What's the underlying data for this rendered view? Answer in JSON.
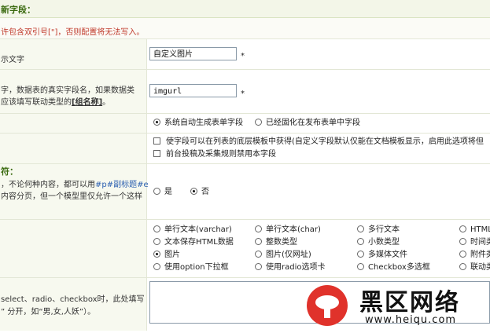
{
  "header": {
    "title": "新字段："
  },
  "warning": {
    "text": "许包含双引号[\"]，否则配置将无法写入。"
  },
  "label_row": {
    "label": "示文字",
    "value": "自定义图片",
    "required_mark": "*"
  },
  "name_row": {
    "label_line1": "字，数据表的真实字段名，如果数据类",
    "label_line2_prefix": "应该填写联动类型的",
    "label_line2_link": "[组名称]",
    "label_line2_suffix": "。",
    "value": "imgurl",
    "required_mark": "*"
  },
  "form_type": {
    "options": [
      {
        "label": "系统自动生成表单字段",
        "checked": true
      },
      {
        "label": "已经固化在发布表单中字段",
        "checked": false
      }
    ]
  },
  "extra": {
    "checkboxes": [
      {
        "label": "使字段可以在列表的底层模板中获得(自定义字段默认仅能在文档模板显示，启用此选项将但"
      },
      {
        "label": "前台投稿及采集规则禁用本字段"
      }
    ]
  },
  "paging_row": {
    "title": "符：",
    "line1_pre": "，不论何种内容，都可以用",
    "line1_hl": "#p#副标题#e",
    "line2": "内容分页，但一个模型里仅允许一个这样",
    "options": [
      {
        "label": "是",
        "checked": false
      },
      {
        "label": "否",
        "checked": true
      }
    ]
  },
  "data_types": {
    "options": [
      {
        "label": "单行文本(varchar)",
        "checked": false
      },
      {
        "label": "单行文本(char)",
        "checked": false
      },
      {
        "label": "多行文本",
        "checked": false
      },
      {
        "label": "HTML文",
        "checked": false
      },
      {
        "label": "文本保存HTML数据",
        "checked": false
      },
      {
        "label": "整数类型",
        "checked": false
      },
      {
        "label": "小数类型",
        "checked": false
      },
      {
        "label": "时间类",
        "checked": false
      },
      {
        "label": "图片",
        "checked": true
      },
      {
        "label": "图片(仅网址)",
        "checked": false
      },
      {
        "label": "多媒体文件",
        "checked": false
      },
      {
        "label": "附件类",
        "checked": false
      },
      {
        "label": "使用option下拉框",
        "checked": false
      },
      {
        "label": "使用radio选项卡",
        "checked": false
      },
      {
        "label": "Checkbox多选框",
        "checked": false
      },
      {
        "label": "联动类",
        "checked": false
      }
    ]
  },
  "default_row": {
    "line1": "select、radio、checkbox时，此处填写",
    "line2": "” 分开，如“男,女,人妖”）。",
    "value": ""
  },
  "watermark": {
    "name": "黑区网络",
    "url": "www.heiqu.com"
  },
  "colors": {
    "accent": "#3b6b10",
    "warning": "#c0392b",
    "logo_red": "#e0322b"
  }
}
